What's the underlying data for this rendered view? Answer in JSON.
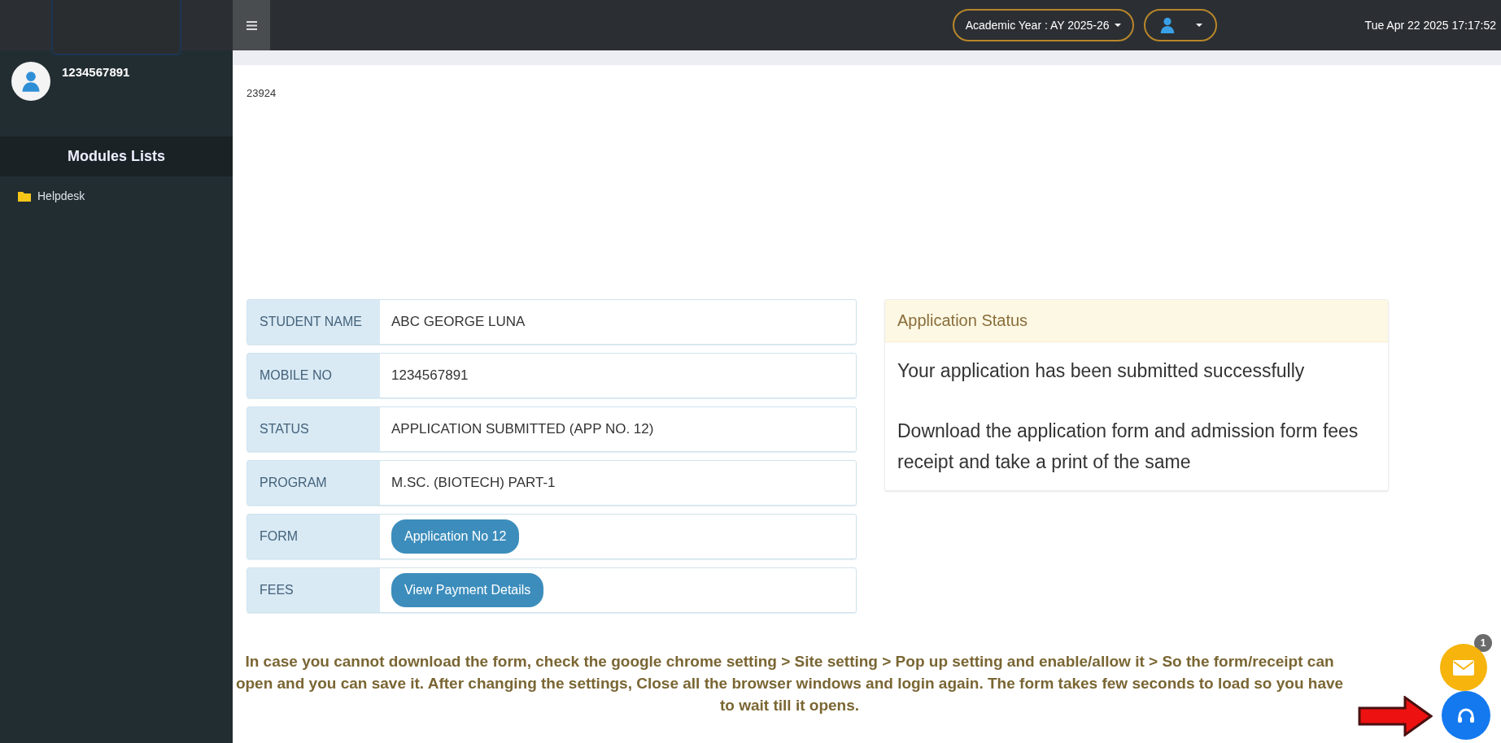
{
  "sidebar": {
    "user_id": "1234567891",
    "section_title": "Modules Lists",
    "items": [
      {
        "label": "Helpdesk"
      }
    ]
  },
  "topbar": {
    "academic_year": "Academic Year : AY 2025-26",
    "datetime": "Tue Apr 22 2025 17:17:52"
  },
  "page_code": "23924",
  "details": {
    "rows": [
      {
        "label": "STUDENT NAME",
        "kind": "text",
        "value": "ABC GEORGE LUNA"
      },
      {
        "label": "MOBILE NO",
        "kind": "text",
        "value": "1234567891"
      },
      {
        "label": "STATUS",
        "kind": "text",
        "value": "APPLICATION SUBMITTED (APP NO. 12)"
      },
      {
        "label": "PROGRAM",
        "kind": "text",
        "value": "M.SC. (BIOTECH) PART-1"
      },
      {
        "label": "FORM",
        "kind": "button",
        "value": "Application No 12"
      },
      {
        "label": "FEES",
        "kind": "button",
        "value": "View Payment Details"
      }
    ]
  },
  "application_status": {
    "title": "Application Status",
    "messages": [
      "Your application has been submitted successfully",
      "Download the application form and admission form fees receipt and take a print of the same"
    ]
  },
  "notice": "In case you cannot download the form, check the google chrome setting > Site setting > Pop up setting and enable/allow it > So the form/receipt can open and you can save it. After changing the settings, Close all the browser windows and login again. The form takes few seconds to load so you have to wait till it opens.",
  "mail_button": {
    "badge": "1"
  }
}
